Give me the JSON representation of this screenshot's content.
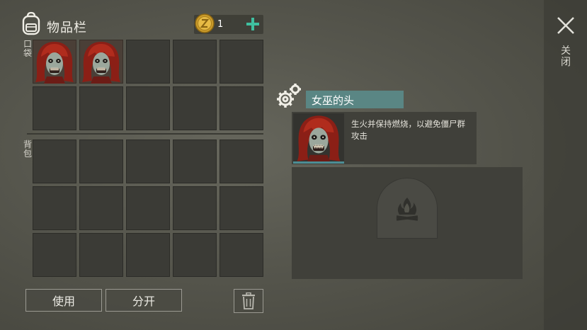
{
  "header": {
    "title": "物品栏",
    "coin_count": "1"
  },
  "sections": {
    "pocket_label": "口袋",
    "bag_label": "背包"
  },
  "inventory": {
    "pocket_slots": [
      {
        "item": "witch-head"
      },
      {
        "item": "witch-head"
      },
      {
        "item": null
      },
      {
        "item": null
      },
      {
        "item": null
      },
      {
        "item": null
      },
      {
        "item": null
      },
      {
        "item": null
      },
      {
        "item": null
      },
      {
        "item": null
      }
    ],
    "bag_slots": 15
  },
  "actions": {
    "use_label": "使用",
    "split_label": "分开"
  },
  "selected_item": {
    "name": "女巫的头",
    "description": "生火并保持燃烧，以避免僵尸群攻击"
  },
  "close_label": "关闭",
  "colors": {
    "accent_teal": "#5a8684",
    "durability": "#4d8d94",
    "add_plus": "#3fbfa0"
  },
  "icons": [
    "backpack-icon",
    "coin-icon",
    "plus-icon",
    "gear-icon",
    "trash-icon",
    "campfire-icon",
    "close-icon"
  ]
}
